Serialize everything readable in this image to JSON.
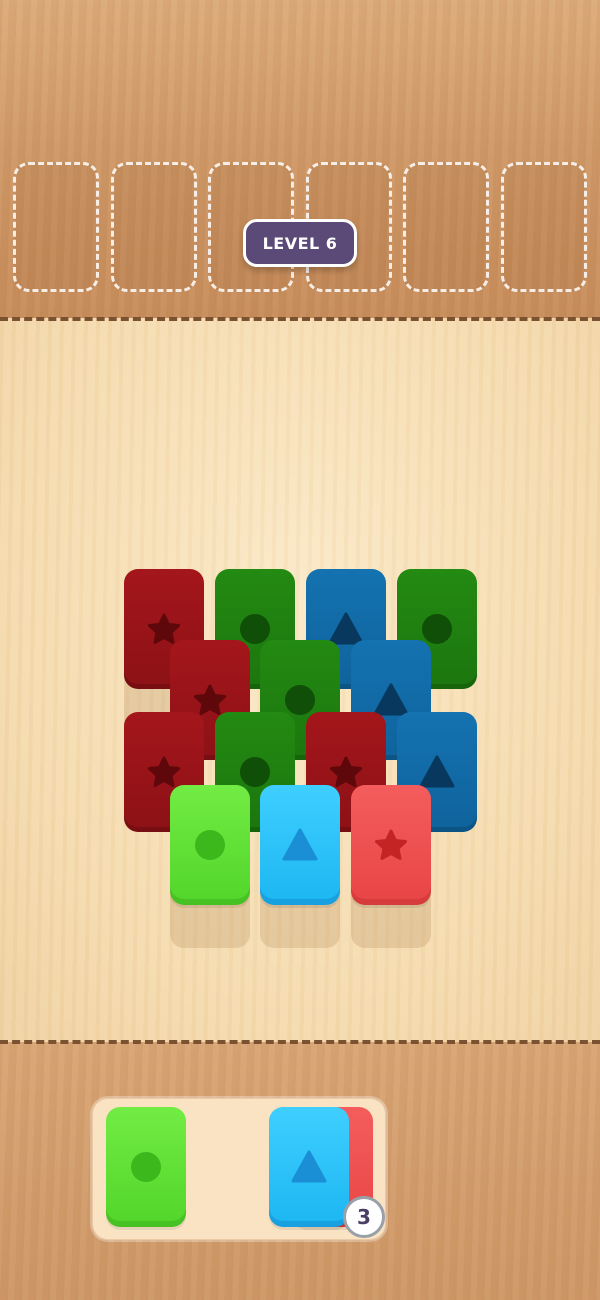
{
  "header": {
    "level_label": "LEVEL 6"
  },
  "slots": {
    "count": 6
  },
  "colors": {
    "dark_red": "#a4161b",
    "dark_green": "#238a12",
    "dark_blue": "#1472b0",
    "light_green": "#5fe033",
    "light_blue": "#24bdf8",
    "light_red": "#ee4f4f",
    "level_badge": "#5b4a78"
  },
  "tiles": [
    {
      "row": "back",
      "color": "dark-red",
      "shape": "star-icon"
    },
    {
      "row": "back",
      "color": "dark-green",
      "shape": "circle-icon"
    },
    {
      "row": "back",
      "color": "dark-blue",
      "shape": "triangle-icon"
    },
    {
      "row": "back",
      "color": "dark-green",
      "shape": "circle-icon"
    },
    {
      "row": "middle",
      "color": "dark-red",
      "shape": "star-icon"
    },
    {
      "row": "middle",
      "color": "dark-green",
      "shape": "circle-icon"
    },
    {
      "row": "middle",
      "color": "dark-blue",
      "shape": "triangle-icon"
    },
    {
      "row": "lower",
      "color": "dark-red",
      "shape": "star-icon"
    },
    {
      "row": "lower",
      "color": "dark-green",
      "shape": "circle-icon"
    },
    {
      "row": "lower",
      "color": "dark-red",
      "shape": "star-icon"
    },
    {
      "row": "lower",
      "color": "dark-blue",
      "shape": "triangle-icon"
    },
    {
      "row": "front",
      "color": "light-green",
      "shape": "circle-icon"
    },
    {
      "row": "front",
      "color": "light-blue",
      "shape": "triangle-icon"
    },
    {
      "row": "front",
      "color": "light-red",
      "shape": "star-icon"
    }
  ],
  "tray": {
    "tiles": [
      {
        "color": "light-green",
        "shape": "circle-icon"
      },
      {
        "color": "light-blue",
        "shape": "triangle-icon"
      }
    ],
    "stack_count": "3"
  }
}
